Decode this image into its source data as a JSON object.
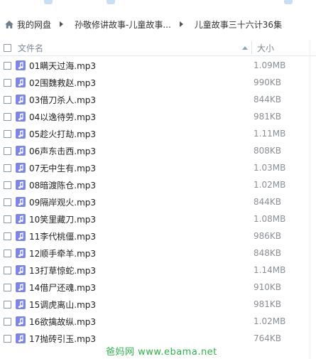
{
  "breadcrumb": {
    "items": [
      "我的网盘",
      "孙敬修讲故事-儿童故事...",
      "儿童故事三十六计36集"
    ]
  },
  "columns": {
    "name": "文件名",
    "size": "大小"
  },
  "file_icon": "music-note-icon",
  "colors": {
    "file_icon_bg": "#7d86e0",
    "watermark": "#2fb24a"
  },
  "files": [
    {
      "name": "01瞒天过海.mp3",
      "size": "1.09MB"
    },
    {
      "name": "02围魏救赵.mp3",
      "size": "990KB"
    },
    {
      "name": "03借刀杀人.mp3",
      "size": "844KB"
    },
    {
      "name": "04以逸待劳.mp3",
      "size": "981KB"
    },
    {
      "name": "05趁火打劫.mp3",
      "size": "1.11MB"
    },
    {
      "name": "06声东击西.mp3",
      "size": "808KB"
    },
    {
      "name": "07无中生有.mp3",
      "size": "1.03MB"
    },
    {
      "name": "08暗渡陈仓.mp3",
      "size": "1.02MB"
    },
    {
      "name": "09隔岸观火.mp3",
      "size": "844KB"
    },
    {
      "name": "10笑里藏刀.mp3",
      "size": "1.08MB"
    },
    {
      "name": "11李代桃僵.mp3",
      "size": "986KB"
    },
    {
      "name": "12顺手牵羊.mp3",
      "size": "848KB"
    },
    {
      "name": "13打草惊蛇.mp3",
      "size": "1.14MB"
    },
    {
      "name": "14借尸还魂.mp3",
      "size": "910KB"
    },
    {
      "name": "15调虎离山.mp3",
      "size": "981KB"
    },
    {
      "name": "16欲擒故纵.mp3",
      "size": "1.02MB"
    },
    {
      "name": "17抛砖引玉.mp3",
      "size": "764KB"
    }
  ],
  "watermark": "爸妈网 www.ebama.net"
}
